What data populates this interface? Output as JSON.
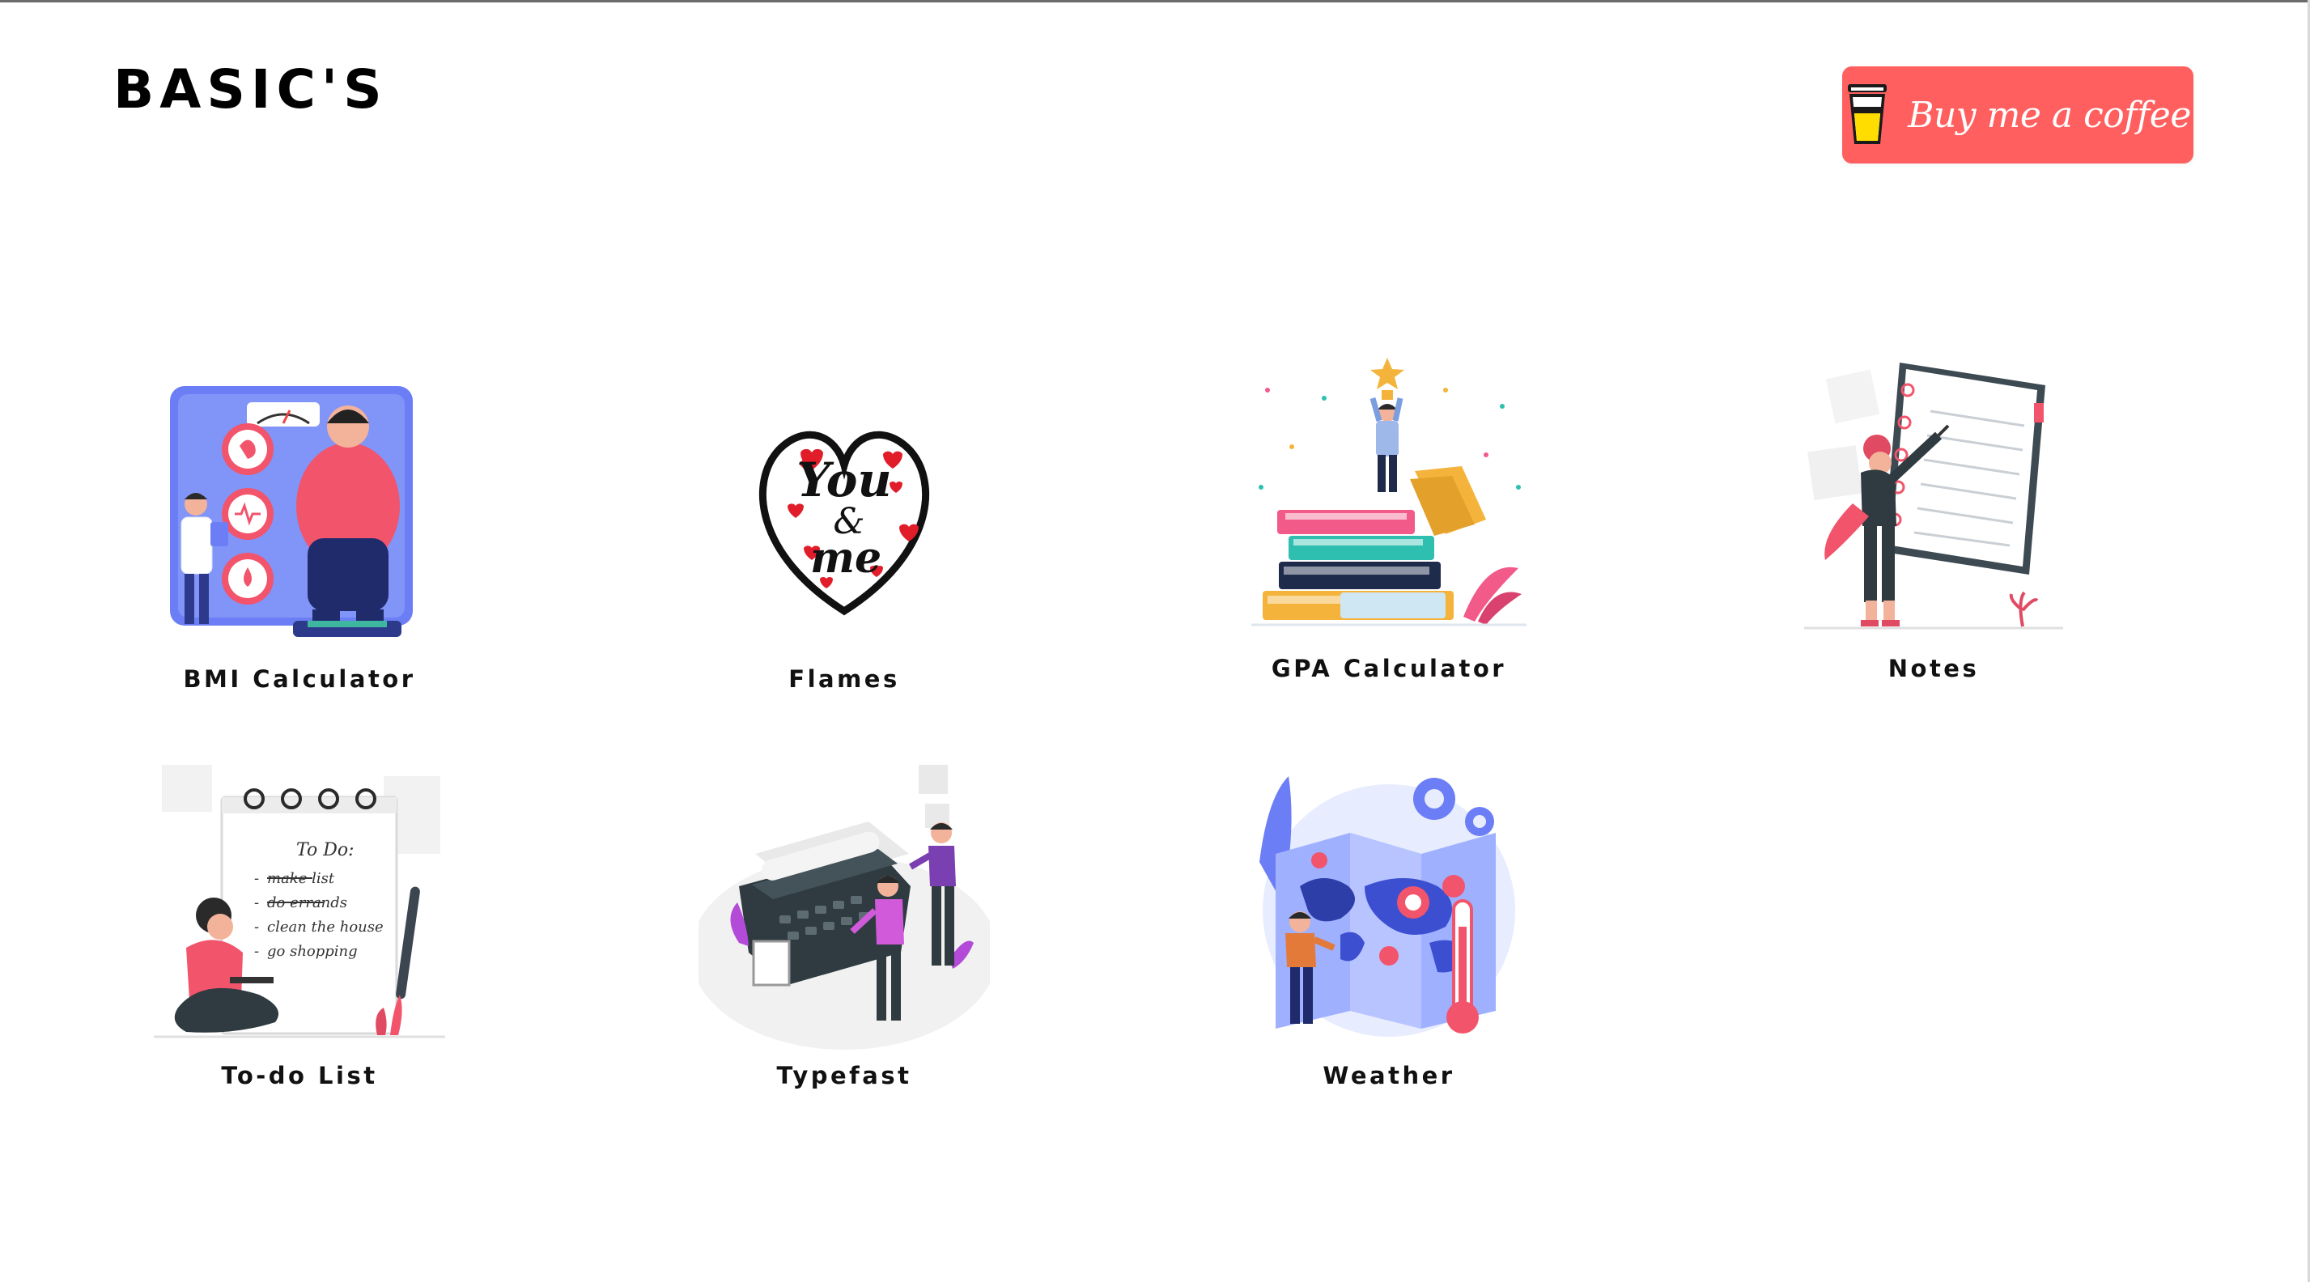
{
  "header": {
    "title": "BASIC'S",
    "coffee_button": {
      "label": "Buy me a coffee",
      "icon": "coffee-cup-icon",
      "color": "#FF5F5F"
    }
  },
  "apps": [
    {
      "name": "BMI Calculator",
      "icon": "bmi-scale-illustration"
    },
    {
      "name": "Flames",
      "icon": "heart-you-and-me-illustration"
    },
    {
      "name": "GPA Calculator",
      "icon": "books-trophy-illustration"
    },
    {
      "name": "Notes",
      "icon": "notebook-writing-illustration"
    },
    {
      "name": "To-do List",
      "icon": "todo-notepad-illustration"
    },
    {
      "name": "Typefast",
      "icon": "typewriter-illustration"
    },
    {
      "name": "Weather",
      "icon": "weather-map-illustration"
    }
  ],
  "todo_card_text": {
    "heading": "To Do:",
    "items": [
      "make list",
      "do errands",
      "clean the house",
      "go shopping"
    ]
  },
  "flames_card_text": {
    "word_top": "You",
    "word_mid": "&",
    "word_bottom": "me"
  },
  "colors": {
    "background": "#FFFFFF",
    "title": "#000000",
    "accent": "#FF5F5F",
    "illustration_blue": "#6C7EF5",
    "illustration_red": "#F2546B"
  }
}
